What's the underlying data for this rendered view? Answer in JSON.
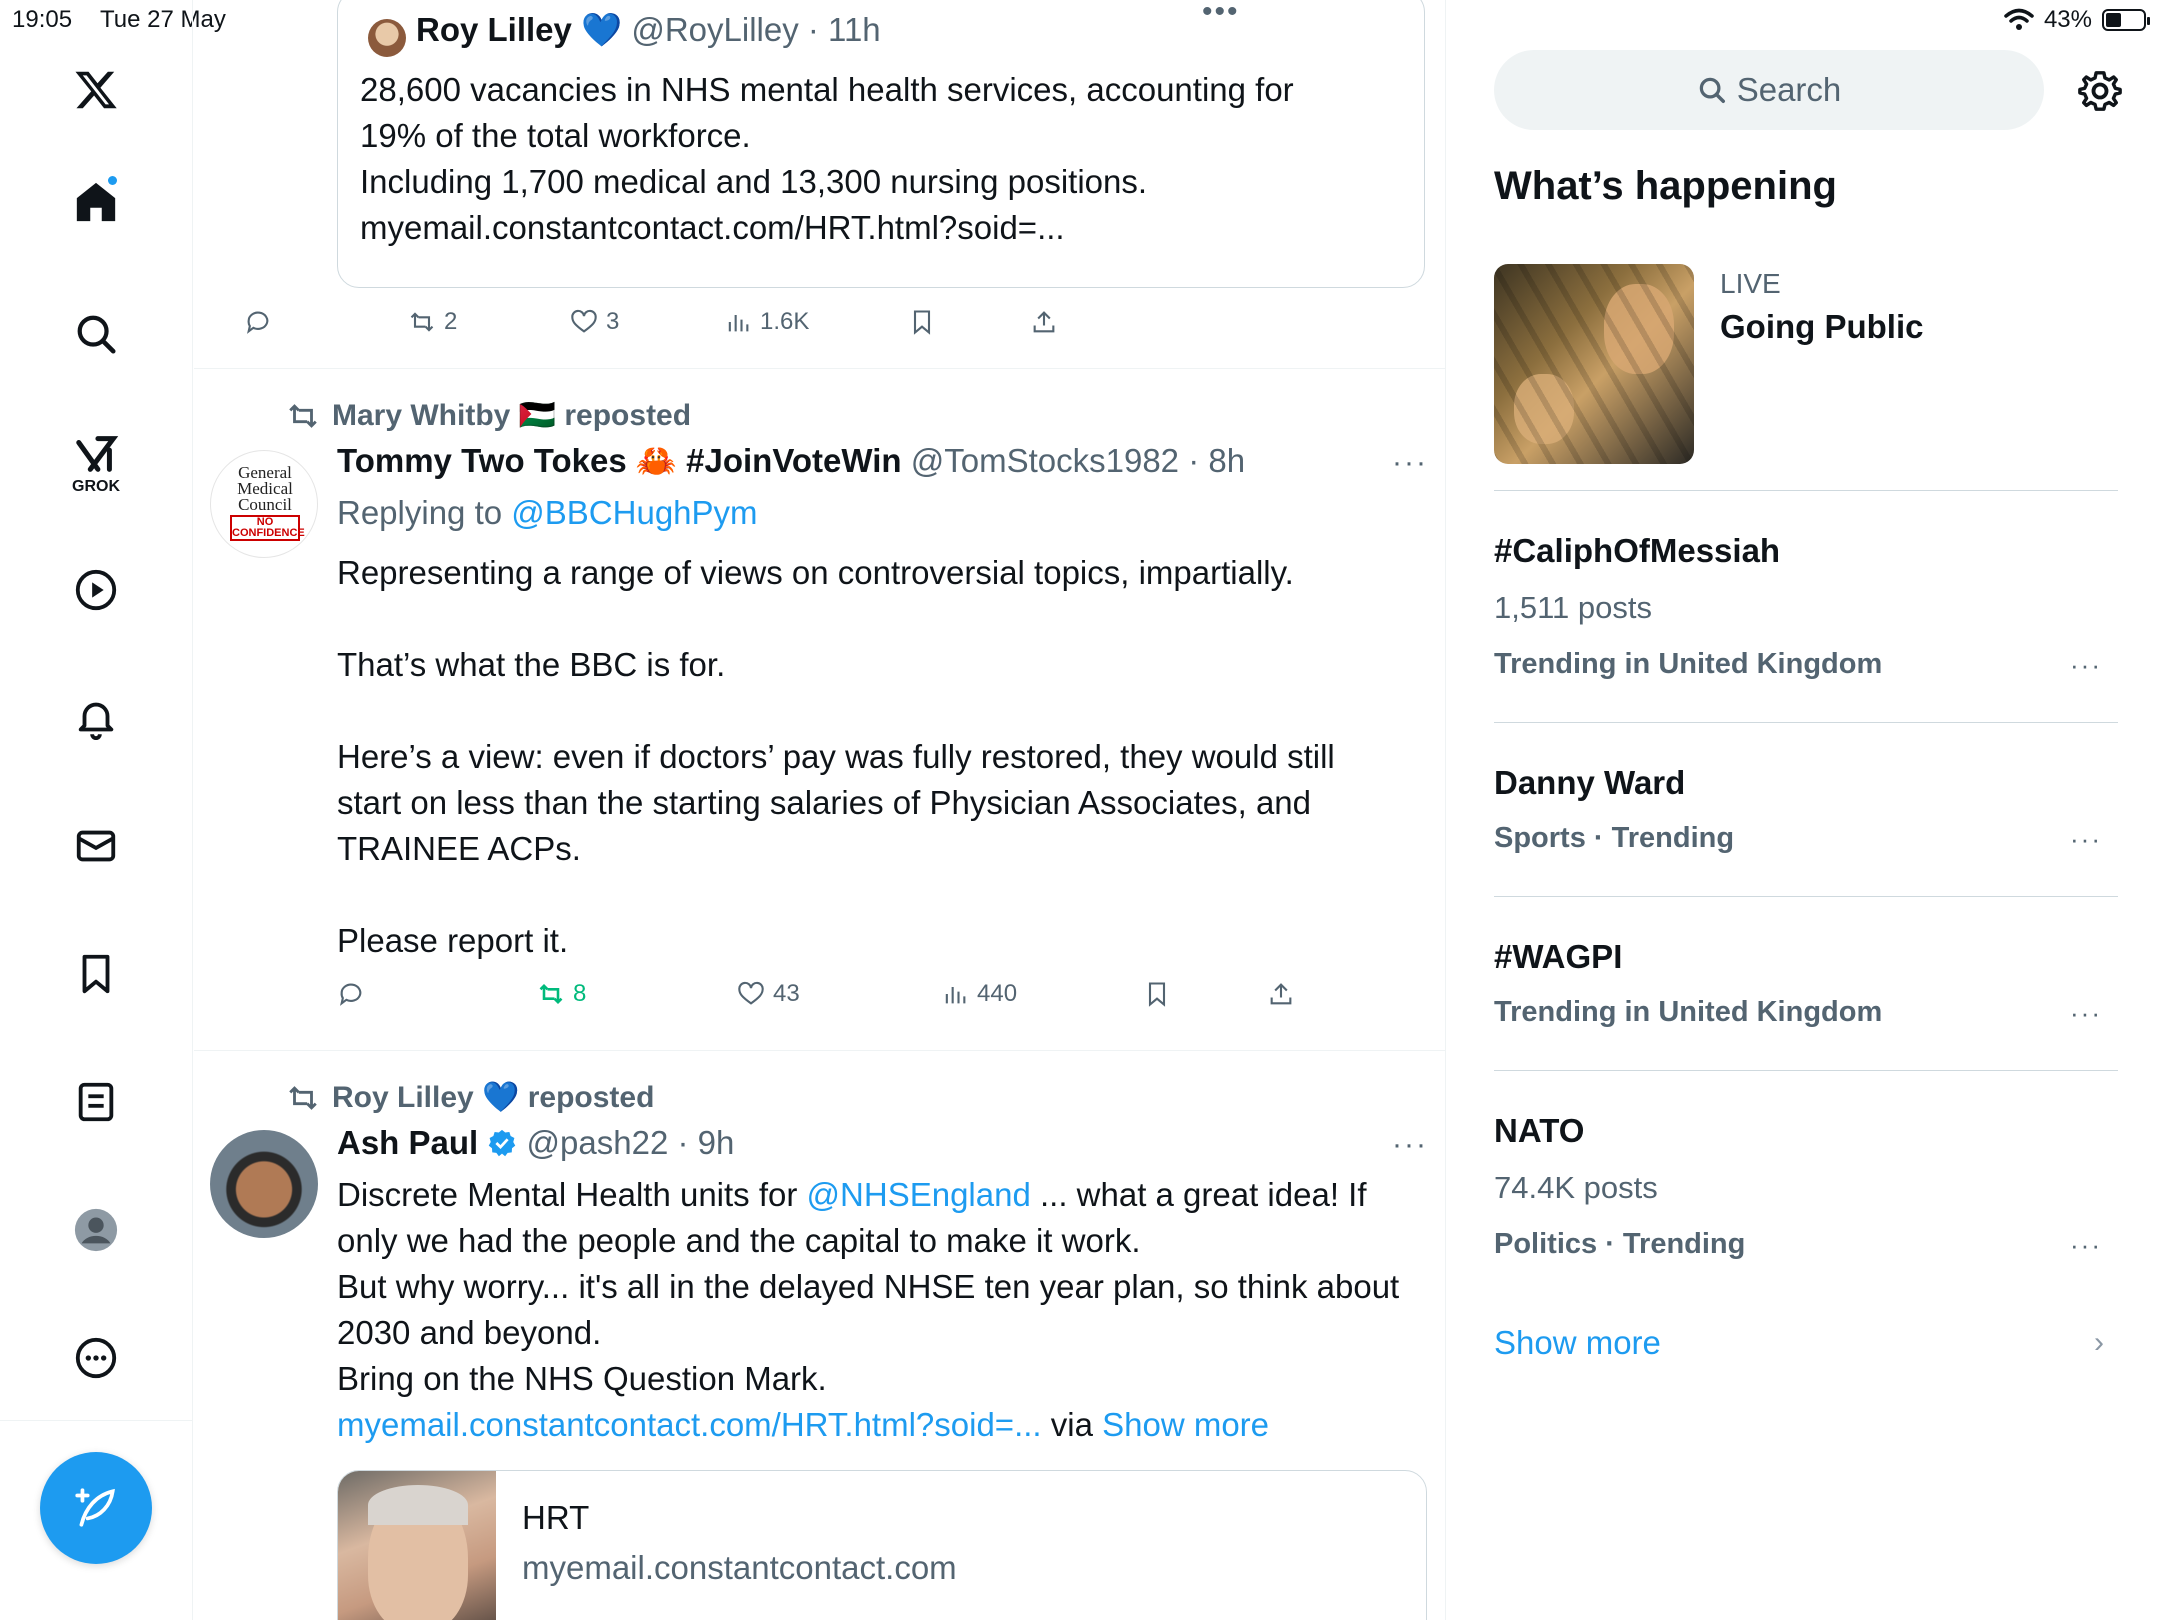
{
  "status_bar": {
    "time": "19:05",
    "date": "Tue 27 May",
    "battery": "43%",
    "battery_level": 0.43
  },
  "nav": {
    "grok_label": "GROK"
  },
  "quoted_tweet": {
    "name": "Roy Lilley",
    "badge": "💙",
    "handle": "@RoyLilley",
    "time": "· 11h",
    "more": "•••",
    "lines": [
      "28,600 vacancies in NHS mental health services, accounting for",
      "19% of the total workforce.",
      "Including 1,700 medical and 13,300 nursing positions.",
      "myemail.constantcontact.com/HRT.html?soid=..."
    ]
  },
  "tweet1_actions": {
    "retweets": "2",
    "likes": "3",
    "views": "1.6K"
  },
  "tweet2": {
    "reposter": "Mary Whitby 🇵🇸 reposted",
    "name": "Tommy Two Tokes 🦀 #JoinVoteWin",
    "handle": "@TomStocks1982",
    "time": "· 8h",
    "more": "···",
    "replying_prefix": "Replying to",
    "replying_to": "@BBCHughPym",
    "avatar_text": [
      "General",
      "Medical",
      "Council",
      "NO",
      "CONFIDENCE"
    ],
    "paragraphs": [
      "Representing a range of views on controversial topics, impartially.",
      "That’s what the BBC is for.",
      "Here’s a view:  even if doctors’ pay was fully restored, they would still start on less than the starting salaries of Physician Associates, and TRAINEE ACPs.",
      "Please report it."
    ],
    "retweets": "8",
    "likes": "43",
    "views": "440"
  },
  "tweet3": {
    "reposter": "Roy Lilley 💙 reposted",
    "name": "Ash Paul",
    "handle": "@pash22",
    "time": "· 9h",
    "more": "···",
    "text_1": "Discrete Mental Health units for ",
    "mention": "@NHSEngland",
    "text_2": " ... what a great idea! If only we had the people and the capital to make it work.",
    "text_3": "But why worry... it's all in the delayed NHSE ten year plan, so think about 2030 and beyond.",
    "text_4": "Bring on the NHS Question Mark.",
    "link": "myemail.constantcontact.com/HRT.html?soid=...",
    "via": " via ",
    "show_more": "Show more",
    "card_title": "HRT",
    "card_domain": "myemail.constantcontact.com"
  },
  "right": {
    "search_placeholder": "Search",
    "heading": "What’s happening",
    "live_tag": "LIVE",
    "live_title": "Going Public",
    "trends": [
      {
        "title": "#CaliphOfMessiah",
        "posts": "1,511 posts",
        "meta": "Trending in United Kingdom"
      },
      {
        "title": "Danny Ward",
        "posts": "",
        "meta": "Sports · Trending"
      },
      {
        "title": "#WAGPI",
        "posts": "",
        "meta": "Trending in United Kingdom"
      },
      {
        "title": "NATO",
        "posts": "74.4K posts",
        "meta": "Politics · Trending"
      }
    ],
    "trend_more": "···",
    "show_more": "Show more",
    "chevron": "›"
  }
}
